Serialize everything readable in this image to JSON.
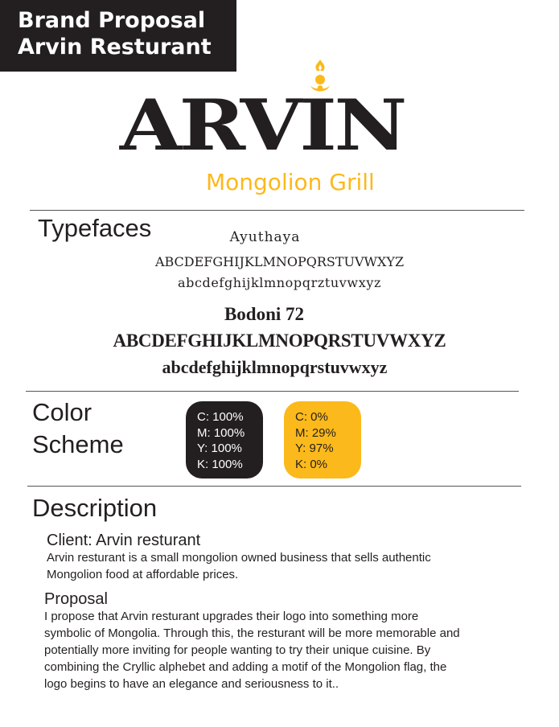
{
  "header": {
    "line1": "Brand Proposal",
    "line2": "Arvin Resturant"
  },
  "logo": {
    "wordmark": "ARVIN",
    "tagline": "Mongolion Grill",
    "icon": "soyombo-flame-icon",
    "colors": {
      "dark": "#231f20",
      "accent": "#fbb91b"
    }
  },
  "typefaces": {
    "heading": "Typefaces",
    "faces": [
      {
        "name": "Ayuthaya",
        "uppercase": "ABCDEFGHIJKLMNOPQRSTUVWXYZ",
        "lowercase": "abcdefghijklmnopqrztuvwxyz"
      },
      {
        "name": "Bodoni 72",
        "uppercase": "ABCDEFGHIJKLMNOPQRSTUVWXYZ",
        "lowercase": "abcdefghijklmnopqrstuvwxyz"
      }
    ]
  },
  "color_scheme": {
    "heading_line1": "Color",
    "heading_line2": "Scheme",
    "swatches": [
      {
        "color": "#231f20",
        "c": "C: 100%",
        "m": "M: 100%",
        "y": "Y: 100%",
        "k": "K: 100%"
      },
      {
        "color": "#fbb91b",
        "c": "C: 0%",
        "m": "M: 29%",
        "y": "Y: 97%",
        "k": "K: 0%"
      }
    ]
  },
  "description": {
    "heading": "Description",
    "client_title": "Client: Arvin resturant",
    "client_lines": [
      "Arvin resturant is a small mongolion owned business that sells authentic",
      "Mongolion food at affordable prices."
    ],
    "proposal_title": "Proposal",
    "proposal_lines": [
      "I propose that Arvin resturant upgrades their logo into something more",
      "symbolic of Mongolia. Through this, the resturant will be more memorable and",
      "potentially more inviting for people wanting to try their unique cuisine. By",
      "combining the Cryllic alphebet and adding a motif of the Mongolion flag, the",
      "logo begins to have an elegance and seriousness to it.."
    ]
  }
}
